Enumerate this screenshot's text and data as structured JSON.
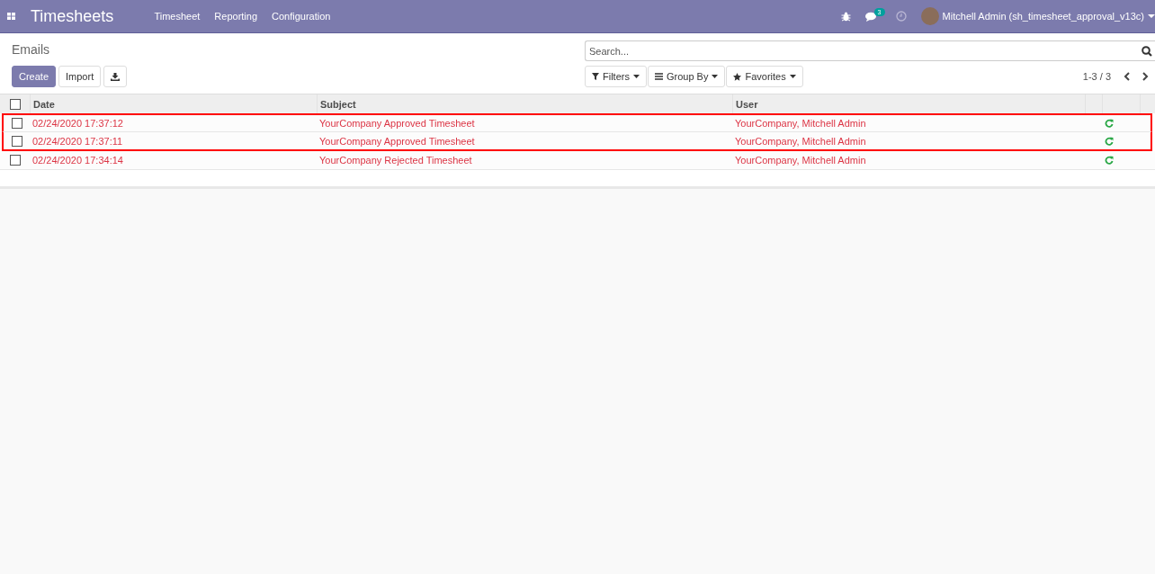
{
  "navbar": {
    "app_title": "Timesheets",
    "menu": [
      "Timesheet",
      "Reporting",
      "Configuration"
    ],
    "messages_count": "3",
    "user": "Mitchell Admin (sh_timesheet_approval_v13c)"
  },
  "breadcrumb": "Emails",
  "buttons": {
    "create": "Create",
    "import": "Import"
  },
  "search": {
    "placeholder": "Search..."
  },
  "filters": [
    "Filters",
    "Group By",
    "Favorites"
  ],
  "pager": "1-3 / 3",
  "table": {
    "select_all_checked": false,
    "columns": [
      "Date",
      "Subject",
      "User"
    ],
    "rows": [
      {
        "date": "02/24/2020 17:37:12",
        "subject": "YourCompany Approved Timesheet",
        "user": "YourCompany, Mitchell Admin",
        "checked": false,
        "highlighted": true
      },
      {
        "date": "02/24/2020 17:37:11",
        "subject": "YourCompany Approved Timesheet",
        "user": "YourCompany, Mitchell Admin",
        "checked": false,
        "highlighted": true
      },
      {
        "date": "02/24/2020 17:34:14",
        "subject": "YourCompany Rejected Timesheet",
        "user": "YourCompany, Mitchell Admin",
        "checked": false,
        "highlighted": false
      }
    ]
  }
}
